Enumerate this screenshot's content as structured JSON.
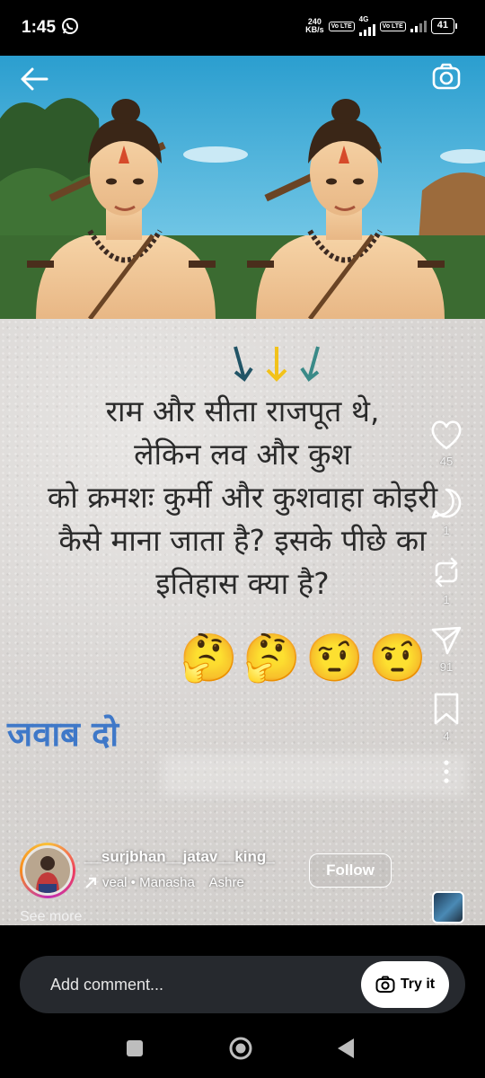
{
  "status_bar": {
    "time": "1:45",
    "net_speed_value": "240",
    "net_speed_unit": "KB/s",
    "network_label": "4G",
    "volte_label": "Vo LTE",
    "battery": "41"
  },
  "post": {
    "text_lines": [
      "राम और सीता राजपूत थे,",
      "लेकिन लव और कुश",
      "को क्रमशः कुर्मी और कुशवाहा कोइरी",
      "कैसे माना जाता है? इसके पीछे का",
      "इतिहास क्या है?"
    ],
    "emojis": [
      "🤔",
      "🤔",
      "🤨",
      "🤨"
    ],
    "answer_text": "जवाब दो"
  },
  "actions": {
    "likes": "45",
    "comments": "1",
    "reposts": "1",
    "shares": "91",
    "saves": "4"
  },
  "author": {
    "username": "__surjbhan__jatav__king_",
    "audio_text": "veal • Manasha    Ashre",
    "follow_label": "Follow"
  },
  "see_more_label": "See more",
  "comment": {
    "placeholder": "Add comment...",
    "try_label": "Try it"
  },
  "icons": {
    "status": "whatsapp-icon",
    "back": "back-arrow-icon",
    "camera": "camera-icon",
    "like": "heart-icon",
    "comment": "comment-icon",
    "repost": "repost-icon",
    "share": "send-icon",
    "save": "bookmark-icon",
    "more": "more-vertical-icon",
    "audio": "arrow-up-right-icon",
    "nav": [
      "recents-square-icon",
      "home-circle-icon",
      "back-triangle-icon"
    ]
  }
}
